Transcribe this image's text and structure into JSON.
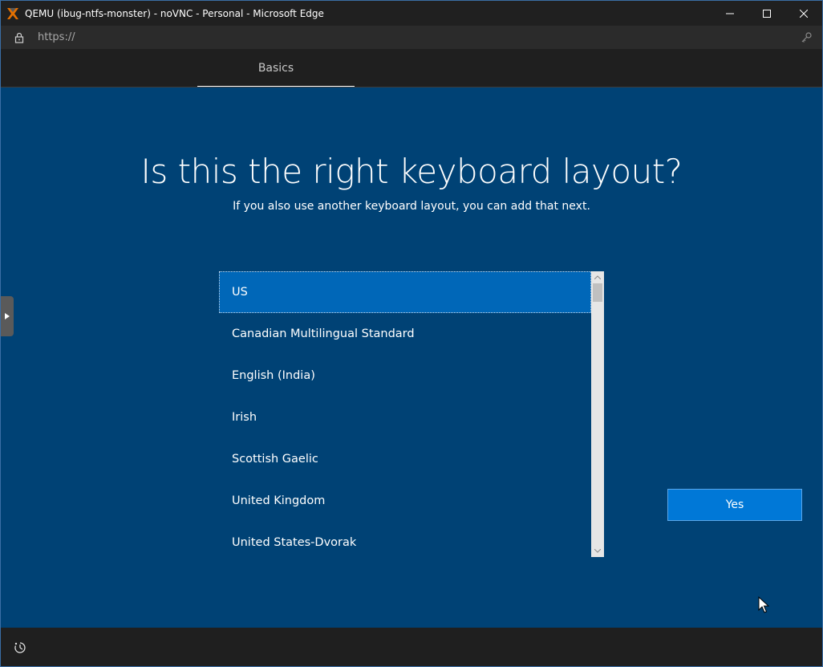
{
  "window": {
    "title": "QEMU (ibug-ntfs-monster) - noVNC - Personal - Microsoft Edge",
    "url": "https://"
  },
  "oobe": {
    "tab_label": "Basics",
    "heading": "Is this the right keyboard layout?",
    "subheading": "If you also use another keyboard layout, you can add that next.",
    "layouts": [
      "US",
      "Canadian Multilingual Standard",
      "English (India)",
      "Irish",
      "Scottish Gaelic",
      "United Kingdom",
      "United States-Dvorak"
    ],
    "selected_layout": "US",
    "yes_label": "Yes"
  },
  "icons": {
    "app": "proxmox-x-icon",
    "lock": "lock-icon",
    "key": "key-icon",
    "accessibility": "ease-of-access-icon"
  },
  "colors": {
    "background": "#004275",
    "selected_item": "#0067b8",
    "button": "#0078d7"
  }
}
